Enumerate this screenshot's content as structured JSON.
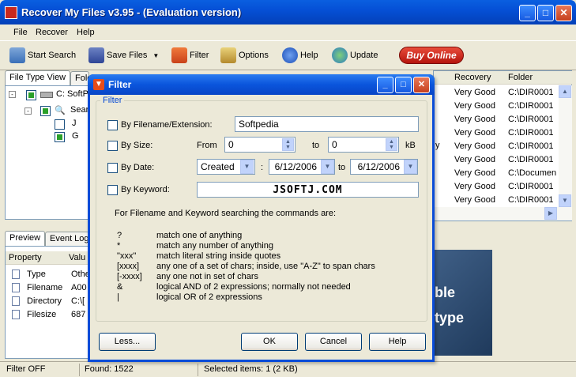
{
  "window": {
    "title": "Recover My Files v3.95  -  (Evaluation version)"
  },
  "menu": [
    "File",
    "Recover",
    "Help"
  ],
  "toolbar": {
    "start_search": "Start Search",
    "save_files": "Save Files",
    "filter": "Filter",
    "options": "Options",
    "help": "Help",
    "update": "Update",
    "buy_online": "Buy Online"
  },
  "left_tabs": [
    "File Type View",
    "Folder"
  ],
  "tree": {
    "drive": "C: SoftP",
    "search": "Sear",
    "item1": "J",
    "item2": "G"
  },
  "results": {
    "columns": [
      "Recovery",
      "Folder"
    ],
    "partial_extra": "y",
    "rows": [
      {
        "recovery": "Very Good",
        "folder": "C:\\DIR0001"
      },
      {
        "recovery": "Very Good",
        "folder": "C:\\DIR0001"
      },
      {
        "recovery": "Very Good",
        "folder": "C:\\DIR0001"
      },
      {
        "recovery": "Very Good",
        "folder": "C:\\DIR0001"
      },
      {
        "recovery": "Very Good",
        "folder": "C:\\DIR0001"
      },
      {
        "recovery": "Very Good",
        "folder": "C:\\DIR0001"
      },
      {
        "recovery": "Very Good",
        "folder": "C:\\Documen"
      },
      {
        "recovery": "Very Good",
        "folder": "C:\\DIR0001"
      },
      {
        "recovery": "Very Good",
        "folder": "C:\\DIR0001"
      }
    ]
  },
  "bottom_tabs": [
    "Preview",
    "Event Log"
  ],
  "properties": {
    "columns": [
      "Property",
      "Valu"
    ],
    "rows": [
      {
        "name": "Type",
        "value": "Othe"
      },
      {
        "name": "Filename",
        "value": "A00"
      },
      {
        "name": "Directory",
        "value": "C:\\["
      },
      {
        "name": "Filesize",
        "value": "687"
      }
    ]
  },
  "preview_text": [
    "ble",
    "type"
  ],
  "status": {
    "filter": "Filter OFF",
    "found": "Found: 1522",
    "selected": "Selected items: 1 (2 KB)"
  },
  "dialog": {
    "title": "Filter",
    "group": "Filter",
    "by_filename": "By Filename/Extension:",
    "filename_value": "Softpedia",
    "by_size": "By Size:",
    "size_from_label": "From",
    "size_from": "0",
    "size_to_label": "to",
    "size_to": "0",
    "size_unit": "kB",
    "by_date": "By Date:",
    "date_type": "Created",
    "date_colon": ":",
    "date_from": "6/12/2006",
    "date_to_label": "to",
    "date_to": "6/12/2006",
    "by_keyword": "By Keyword:",
    "keyword_value": "JSOFTJ.COM",
    "help_intro": "For Filename and Keyword searching the commands are:",
    "commands": [
      {
        "sym": "?",
        "desc": "match one of anything"
      },
      {
        "sym": "*",
        "desc": "match any number of anything"
      },
      {
        "sym": "\"xxx\"",
        "desc": "match literal string inside quotes"
      },
      {
        "sym": "[xxxx]",
        "desc": "any one of a set of chars; inside, use \"A-Z\" to span chars"
      },
      {
        "sym": "[-xxxx]",
        "desc": "any one not in set of chars"
      },
      {
        "sym": "&",
        "desc": "logical AND of 2 expressions; normally not needed"
      },
      {
        "sym": "|",
        "desc": "logical OR of 2 expressions"
      }
    ],
    "less": "Less...",
    "ok": "OK",
    "cancel": "Cancel",
    "help": "Help"
  }
}
